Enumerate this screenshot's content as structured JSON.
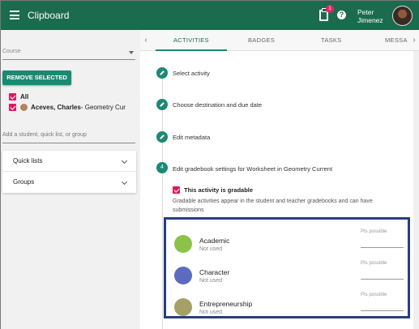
{
  "header": {
    "title": "Clipboard",
    "notification_count": "1",
    "help_symbol": "?",
    "user_first": "Peter",
    "user_last": "Jimenez"
  },
  "left": {
    "course_placeholder": "Course",
    "remove_button": "REMOVE SELECTED",
    "all_label": "All",
    "student_name": "Aceves, Charles",
    "student_course": " - Geometry Cur",
    "add_placeholder": "Add a student, quick list, or group",
    "quick_lists": "Quick lists",
    "groups": "Groups"
  },
  "tabs": {
    "activities": "ACTIVITIES",
    "badges": "BADGES",
    "tasks": "TASKS",
    "messages": "MESSA"
  },
  "steps": [
    {
      "label": "Select activity"
    },
    {
      "label": "Choose destination and due date"
    },
    {
      "label": "Edit metadata"
    },
    {
      "number": "4",
      "label": "Edit gradebook settings for Worksheet in Geometry Current"
    }
  ],
  "gradebook": {
    "gradable_label": "This activity is gradable",
    "description": "Gradable activities appear in the student and teacher gradebooks and can have submissions",
    "categories": [
      {
        "name": "Academic",
        "status": "Not used",
        "pts_label": "Pts possible",
        "color": "#8bc34a"
      },
      {
        "name": "Character",
        "status": "Not used",
        "pts_label": "Pts possible",
        "color": "#5c6bc0"
      },
      {
        "name": "Entrepreneurship",
        "status": "Not used",
        "pts_label": "Pts possible",
        "color": "#a5a065"
      }
    ]
  }
}
